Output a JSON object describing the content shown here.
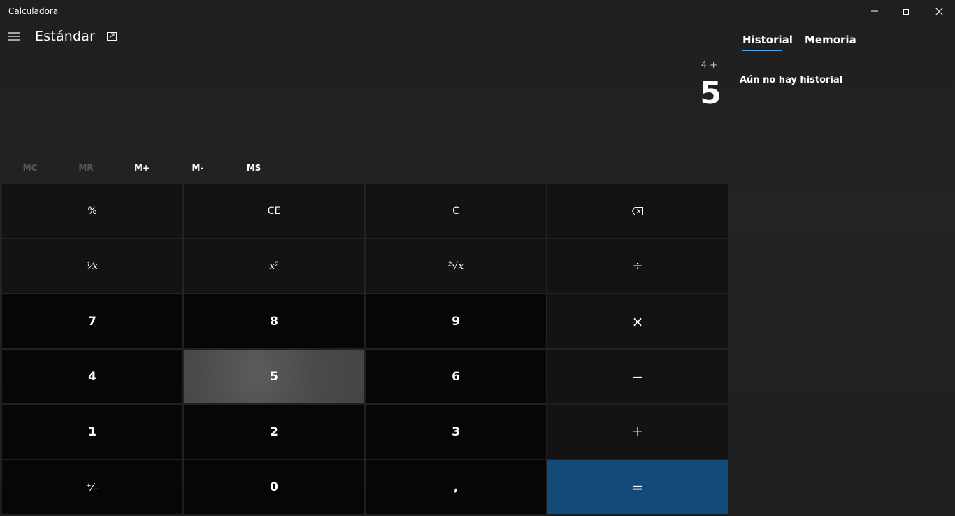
{
  "window": {
    "title": "Calculadora"
  },
  "header": {
    "mode": "Estándar"
  },
  "display": {
    "expression": "4 +",
    "value": "5"
  },
  "memory": {
    "buttons": [
      {
        "label": "MC",
        "enabled": false
      },
      {
        "label": "MR",
        "enabled": false
      },
      {
        "label": "M+",
        "enabled": true
      },
      {
        "label": "M-",
        "enabled": true
      },
      {
        "label": "MS",
        "enabled": true
      }
    ]
  },
  "keys": {
    "percent": "%",
    "ce": "CE",
    "c": "C",
    "backspace_icon": "backspace-icon",
    "reciprocal": "¹⁄x",
    "square": "x²",
    "sqrt": "²√x",
    "divide": "÷",
    "seven": "7",
    "eight": "8",
    "nine": "9",
    "multiply": "×",
    "four": "4",
    "five": "5",
    "six": "6",
    "minus": "−",
    "one": "1",
    "two": "2",
    "three": "3",
    "plus": "+",
    "negate": "⁺⁄₋",
    "zero": "0",
    "decimal": ",",
    "equals": "="
  },
  "panel": {
    "tabs": [
      {
        "label": "Historial",
        "active": true
      },
      {
        "label": "Memoria",
        "active": false
      }
    ],
    "empty_message": "Aún no hay historial"
  },
  "colors": {
    "accent": "#4aa0e6",
    "equals_bg": "#134a7a",
    "hover_key": "#4a4a4a"
  }
}
